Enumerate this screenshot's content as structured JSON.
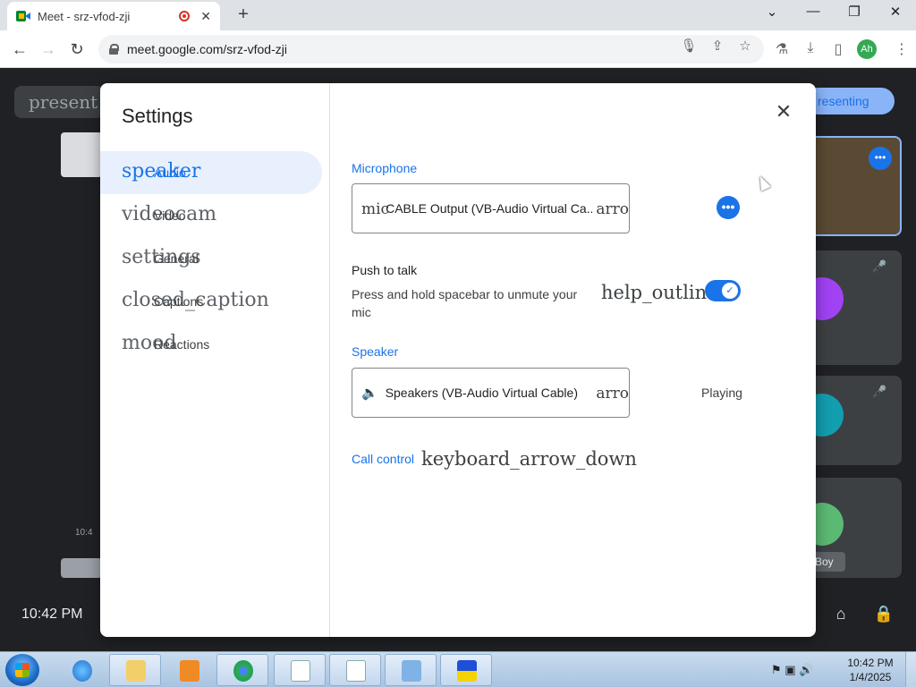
{
  "browser": {
    "tab_title": "Meet - srz-vfod-zji",
    "tab_close": "✕",
    "new_tab": "+",
    "url": "meet.google.com/srz-vfod-zji",
    "avatar_initials": "Ah",
    "window_controls": {
      "minimize": "—",
      "restore": "❐",
      "close": "✕",
      "tab_list": "⌄"
    },
    "nav": {
      "back": "←",
      "forward": "→",
      "reload": "↻"
    },
    "icons": {
      "mic": "🎙",
      "share": "⇪",
      "star": "☆",
      "labs": "⚗",
      "download": "⤓",
      "sidepanel": "▯"
    }
  },
  "meet": {
    "present_label": "present",
    "presenting_label": "resenting",
    "time": "10:42 PM",
    "boy_label": "Boy",
    "left_small": "10:4",
    "tile_more": "•••",
    "mic_off_icon": "🎤̸",
    "bottom_icons": [
      "⌂",
      "🔒"
    ]
  },
  "settings": {
    "title": "Settings",
    "close": "✕",
    "nav": [
      {
        "icon": "speaker",
        "label": "Audio",
        "active": true
      },
      {
        "icon": "videocam",
        "label": "Video",
        "active": false
      },
      {
        "icon": "settings",
        "label": "General",
        "active": false
      },
      {
        "icon": "closed_caption",
        "label": "Captions",
        "active": false
      },
      {
        "icon": "mood",
        "label": "Reactions",
        "active": false
      }
    ],
    "microphone": {
      "heading": "Microphone",
      "icon": "mic",
      "value": "CABLE Output (VB-Audio Virtual Ca...",
      "arrow": "arro",
      "more": "•••"
    },
    "push_to_talk": {
      "title": "Push to talk",
      "description": "Press and hold spacebar to unmute your mic",
      "help_icon": "help_outline",
      "toggle_check": "✓"
    },
    "speaker": {
      "heading": "Speaker",
      "icon": "🔈",
      "value": "Speakers (VB-Audio Virtual Cable)",
      "arrow": "arro",
      "status": "Playing"
    },
    "call_control": {
      "label": "Call control",
      "arrow_icon": "keyboard_arrow_down"
    }
  },
  "taskbar": {
    "tray_icons": "⚑ ▣ 🔊",
    "clock_time": "10:42 PM",
    "clock_date": "1/4/2025"
  }
}
